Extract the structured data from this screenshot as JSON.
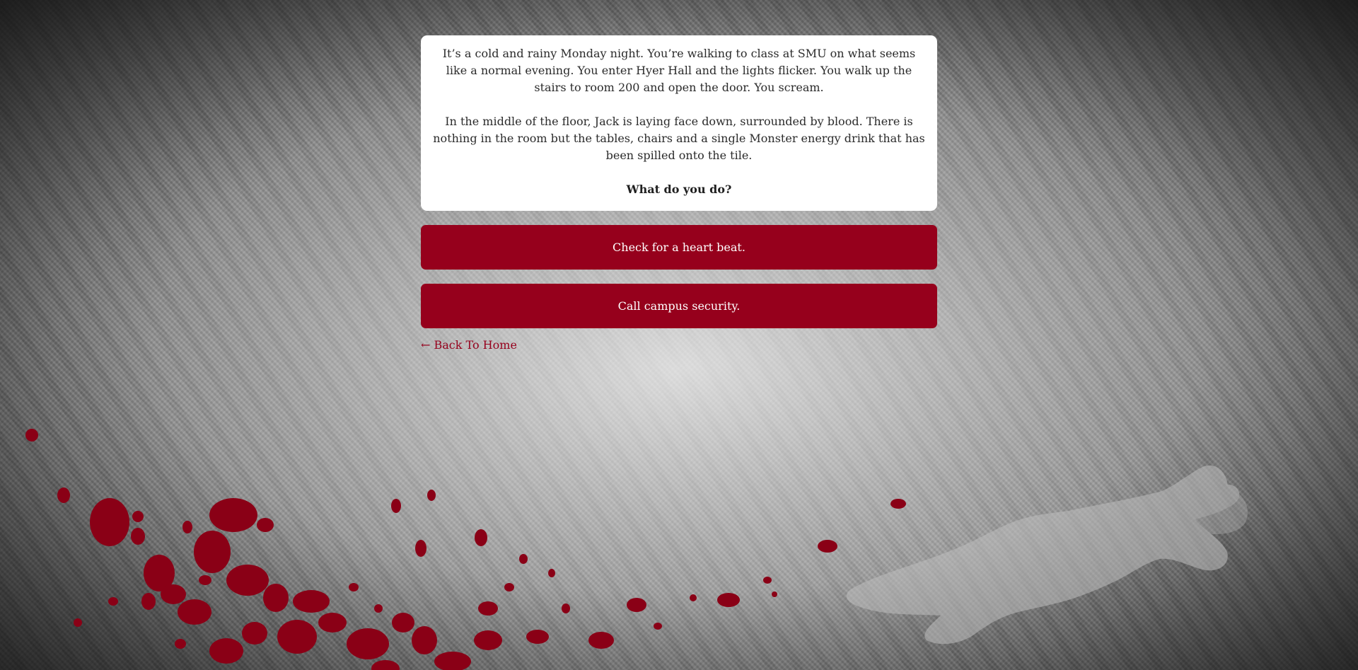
{
  "story": {
    "paragraph_1": "It’s a cold and rainy Monday night. You’re walking to class at SMU on what seems like a normal evening. You enter Hyer Hall and the lights flicker. You walk up the stairs to room 200 and open the door. You scream.",
    "paragraph_2": "In the middle of the floor, Jack is laying face down, surrounded by blood. There is nothing in the room but the tables, chairs and a single Monster energy drink that has been spilled onto the tile.",
    "prompt": "What do you do?"
  },
  "choices": [
    {
      "label": "Check for a heart beat."
    },
    {
      "label": "Call campus security."
    }
  ],
  "nav": {
    "back_label": "← Back To Home"
  },
  "theme": {
    "accent": "#96001c",
    "card_background": "#ffffff",
    "blood_color": "#8a0016",
    "chalk_color": "#c9c9c9"
  },
  "decor": {
    "background": "concrete-texture",
    "blood_splatter": "blood-splatter",
    "chalk_outline": "body-chalk-outline"
  }
}
